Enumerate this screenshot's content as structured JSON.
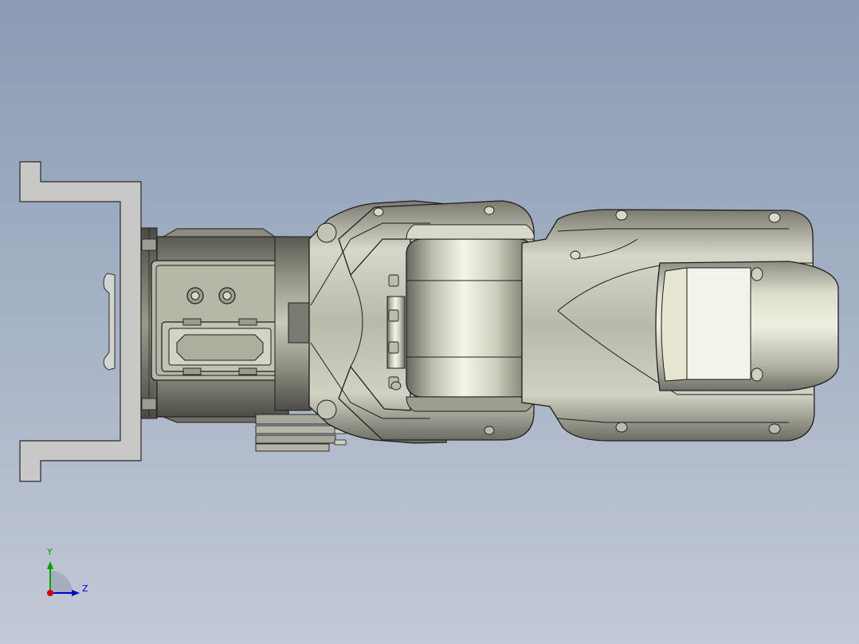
{
  "viewport": {
    "background_top": "#8a9bb3",
    "background_bottom": "#c3c9d6"
  },
  "model": {
    "components": [
      "base-bracket",
      "base-flange",
      "base-motor-housing",
      "connector-panel",
      "shoulder-housing",
      "upper-arm-fork",
      "elbow-cylinder",
      "forearm",
      "wrist-housing"
    ],
    "colors": {
      "bracket_fill": "#c8c8c6",
      "metal_light": "#eeeedd",
      "metal_mid": "#b9b9aa",
      "metal_dark": "#6f6f66",
      "edge": "#1e1e1e"
    }
  },
  "triad": {
    "y_label": "Y",
    "z_label": "Z",
    "colors": {
      "x": "#d00000",
      "y": "#00a000",
      "z": "#0000c8"
    }
  }
}
